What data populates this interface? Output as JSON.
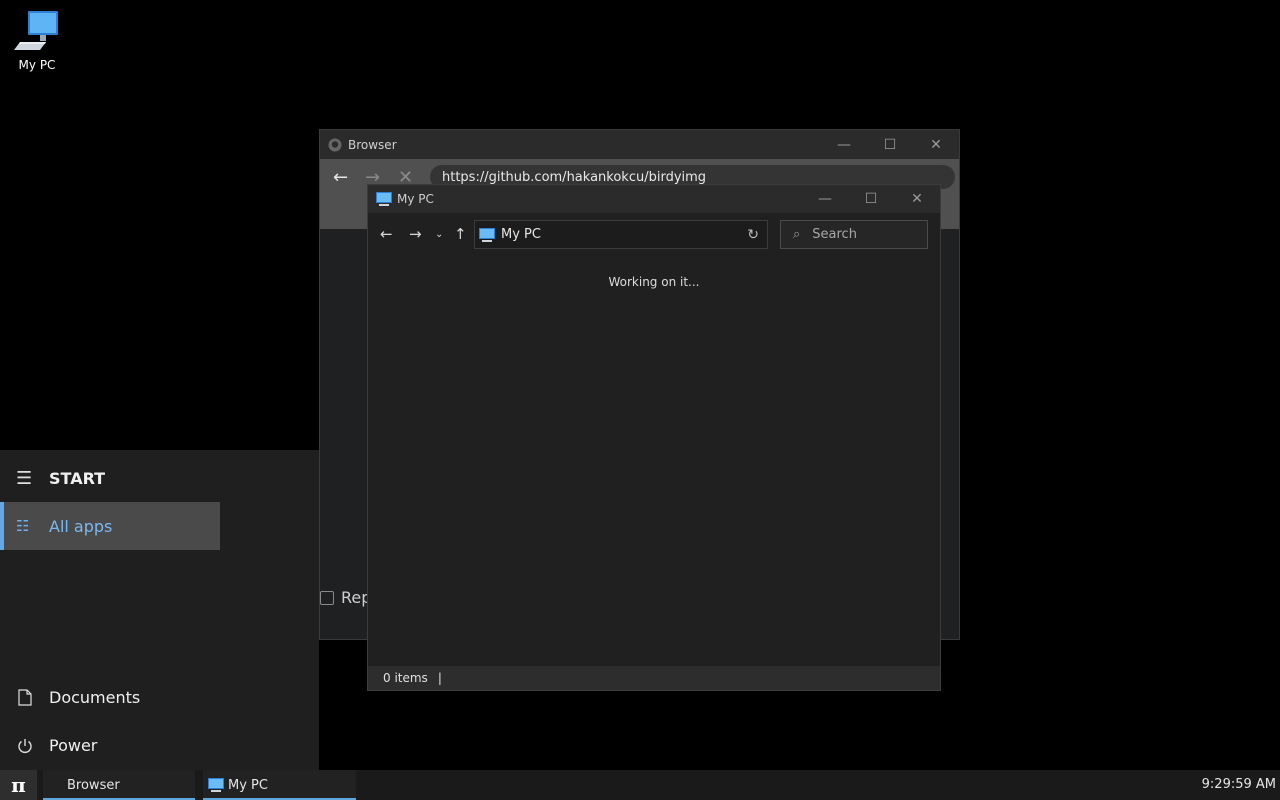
{
  "desktop": {
    "icons": [
      {
        "label": "My PC",
        "icon": "computer-icon"
      }
    ]
  },
  "browser": {
    "title": "Browser",
    "url": "https://github.com/hakankokcu/birdyimg",
    "checkbox_label": "Rep"
  },
  "explorer": {
    "title": "My PC",
    "path": "My PC",
    "search_placeholder": "Search",
    "status_message": "Working on it...",
    "item_count": "0 items",
    "status_separator": "|"
  },
  "start_menu": {
    "header": "START",
    "all_apps": "All apps",
    "items": [
      {
        "label": "Documents",
        "icon": "document-icon"
      },
      {
        "label": "Power",
        "icon": "power-icon"
      }
    ]
  },
  "taskbar": {
    "start_glyph": "π",
    "tasks": [
      {
        "label": "Browser"
      },
      {
        "label": "My PC",
        "icon": "computer-icon"
      }
    ],
    "clock": "9:29:59 AM"
  },
  "colors": {
    "accent": "#62a8e8",
    "desktop_bg": "#000000",
    "window_bg": "#202020"
  }
}
